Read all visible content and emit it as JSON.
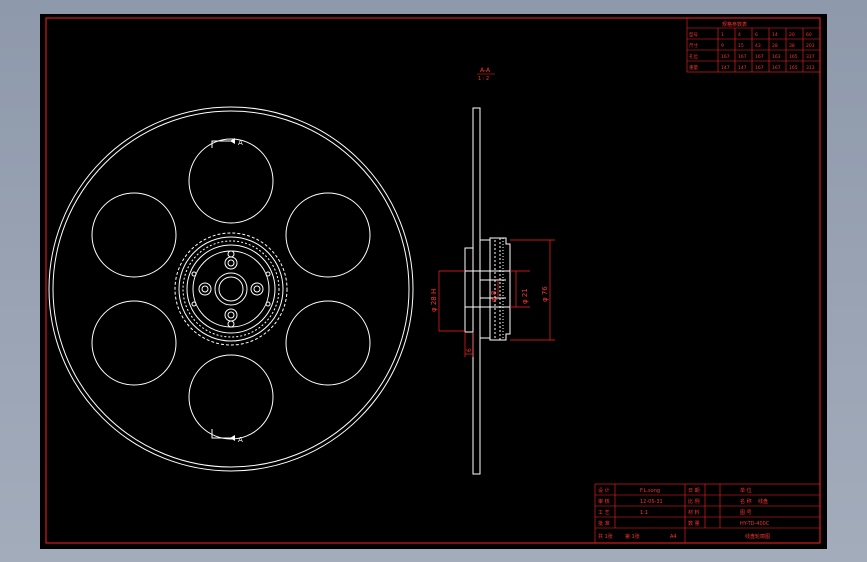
{
  "colors": {
    "background": "#000000",
    "frame": "#ff2020",
    "geometry": "#ffffff",
    "dimension": "#ff2020",
    "window_gradient_top": "#8e99ab"
  },
  "section": {
    "title": "A-A",
    "scale": "1 : 2",
    "marker_top": "A",
    "marker_bottom": "A"
  },
  "dimensions": {
    "d_hub": "φ 28 H",
    "d_inner": "φ 21",
    "d_outer": "φ 76",
    "d_small": "φ 8",
    "thickness": "6"
  },
  "spec_table": {
    "title": "规格参数表",
    "rows": [
      [
        "型号",
        "1",
        "4",
        "6",
        "14",
        "20",
        "60"
      ],
      [
        "尺寸",
        "9",
        "15",
        "43",
        "28",
        "38",
        "203"
      ],
      [
        "孔位",
        "167",
        "167",
        "167",
        "163",
        "165",
        "317"
      ],
      [
        "重量",
        "147",
        "147",
        "167",
        "167",
        "165",
        "313"
      ]
    ]
  },
  "title_block": {
    "row1": [
      "设 计",
      "F.L.song",
      "日 期",
      "",
      "单 位"
    ],
    "row2": [
      "审 核",
      "12-05-31",
      "比 例",
      "",
      "名 称"
    ],
    "row3": [
      "工 艺",
      "1:1",
      "材 料",
      "",
      "图 号"
    ],
    "row4": [
      "批 准",
      "",
      "数 量",
      "",
      "HY-TD-400C"
    ],
    "footer": [
      "共 1张",
      "第 1张",
      "A4",
      "",
      "线盘轮廓图"
    ],
    "scale_val": "1:1",
    "drawing_no": "HY-TD-400C",
    "part_name": "线盘",
    "designer": "F.L.song",
    "date": "12-05-31",
    "sheet": "A4"
  }
}
